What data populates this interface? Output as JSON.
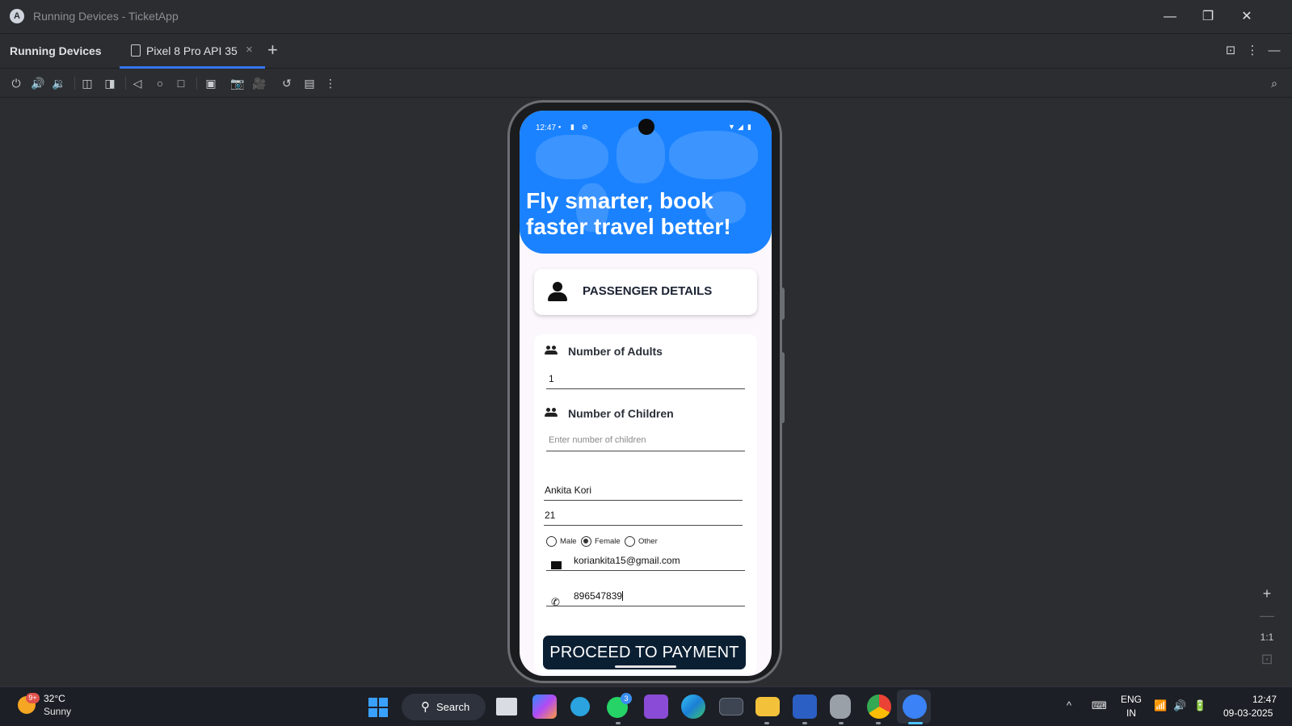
{
  "window": {
    "title": "Running Devices - TicketApp",
    "logo_letter": "A",
    "controls": {
      "minimize": "—",
      "restore": "❐",
      "close": "✕"
    }
  },
  "tabbar": {
    "panel_title": "Running Devices",
    "tabs": [
      {
        "label": "Pixel 8 Pro API 35",
        "close": "×"
      }
    ],
    "add_tab": "+",
    "right_icons": [
      "collapse-icon",
      "more-vert-icon",
      "minimize-panel-icon"
    ],
    "right_glyphs": [
      "⊡",
      "⋮",
      "—"
    ]
  },
  "toolbar": {
    "icons": [
      "power-icon",
      "volume-up-icon",
      "volume-down-icon",
      "rotate-left-icon",
      "rotate-right-icon",
      "back-icon",
      "home-icon",
      "overview-icon",
      "device-frame-icon",
      "screenshot-icon",
      "screen-record-icon",
      "reset-icon",
      "mirror-icon",
      "more-icon",
      "inspect-icon"
    ],
    "glyphs": [
      "⏻",
      "🔊",
      "🔉",
      "◫",
      "◨",
      "◁",
      "○",
      "□",
      "▣",
      "📷",
      "🎥",
      "↺",
      "▤",
      "⋮",
      "⌕"
    ]
  },
  "zoom": {
    "zoom_in": "+",
    "zoom_out": "—",
    "actual_size": "1:1",
    "fit": "⊡"
  },
  "device": {
    "status": {
      "time": "12:47",
      "left_icons": [
        "▪",
        "▮",
        "⊘"
      ],
      "right_icons": [
        "▼",
        "◢",
        "▮"
      ]
    },
    "hero_title": "Fly smarter, book faster travel better!",
    "passenger_card": {
      "label": "PASSENGER DETAILS"
    },
    "form": {
      "adults_label": "Number of Adults",
      "adults_value": "1",
      "children_label": "Number of Children",
      "children_placeholder": "Enter number of children",
      "name_value": "Ankita Kori",
      "age_value": "21",
      "gender_options": [
        "Male",
        "Female",
        "Other"
      ],
      "gender_selected": "Female",
      "email_value": "koriankita15@gmail.com",
      "phone_value": "896547839",
      "phone_glyph": "✆"
    },
    "pay_button": "PROCEED TO PAYMENT"
  },
  "taskbar": {
    "weather": {
      "badge": "9+",
      "temp": "32°C",
      "desc": "Sunny"
    },
    "search_label": "Search",
    "search_glyph": "⚲",
    "apps": [
      "windows-start",
      "task-view",
      "copilot",
      "telegram",
      "whatsapp",
      "visual-studio",
      "edge",
      "terminal",
      "file-explorer",
      "word",
      "database",
      "chrome",
      "android-studio"
    ],
    "whatsapp_badge": "3",
    "tray": {
      "chevron": "^",
      "keyboard": "⌨",
      "lang_top": "ENG",
      "lang_bottom": "IN",
      "wifi": "📶",
      "volume": "🔊",
      "battery": "🔋"
    },
    "clock": {
      "time": "12:47",
      "date": "09-03-2025"
    }
  },
  "colors": {
    "ide_bg": "#2b2d30",
    "accent": "#3574f0",
    "hero_blue": "#1a82ff",
    "pay_button": "#0b1f33",
    "taskbar": "#1c1f26"
  }
}
